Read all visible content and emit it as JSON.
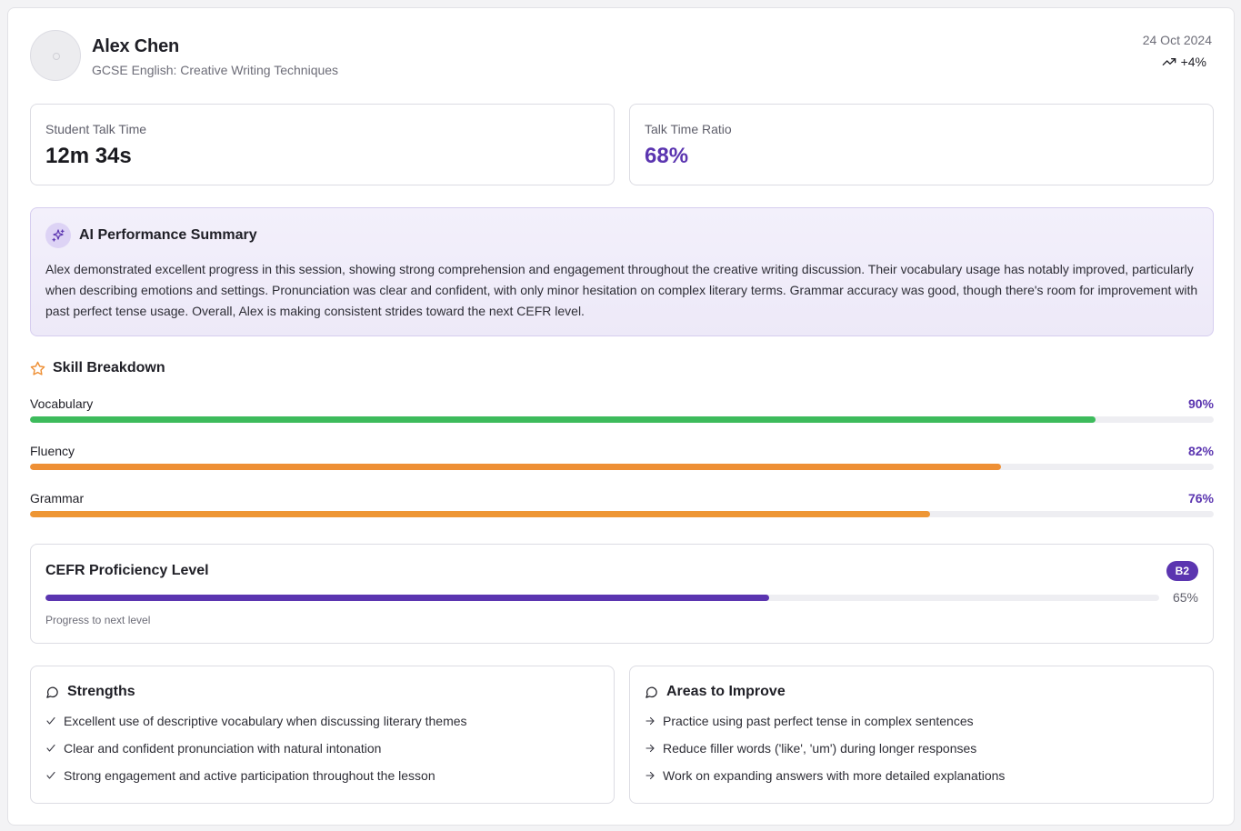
{
  "student": {
    "name": "Alex Chen",
    "course": "GCSE English: Creative Writing Techniques",
    "date": "24 Oct 2024",
    "trend": "+4%"
  },
  "stats": {
    "talk_time": {
      "label": "Student Talk Time",
      "value": "12m 34s"
    },
    "talk_ratio": {
      "label": "Talk Time Ratio",
      "value": "68%"
    }
  },
  "summary": {
    "title": "AI Performance Summary",
    "text": "Alex demonstrated excellent progress in this session, showing strong comprehension and engagement throughout the creative writing discussion. Their vocabulary usage has notably improved, particularly when describing emotions and settings. Pronunciation was clear and confident, with only minor hesitation on complex literary terms. Grammar accuracy was good, though there's room for improvement with past perfect tense usage. Overall, Alex is making consistent strides toward the next CEFR level."
  },
  "skills": {
    "title": "Skill Breakdown",
    "items": [
      {
        "name": "Vocabulary",
        "pct": "90%",
        "value": 0.9,
        "color": "#3dbb5c"
      },
      {
        "name": "Fluency",
        "pct": "82%",
        "value": 0.82,
        "color": "#ee8f34"
      },
      {
        "name": "Grammar",
        "pct": "76%",
        "value": 0.76,
        "color": "#ee9634"
      }
    ]
  },
  "cefr": {
    "title": "CEFR Proficiency Level",
    "level": "B2",
    "progress_label": "65%",
    "progress": 0.65,
    "note": "Progress to next level"
  },
  "strengths": {
    "title": "Strengths",
    "items": [
      "Excellent use of descriptive vocabulary when discussing literary themes",
      "Clear and confident pronunciation with natural intonation",
      "Strong engagement and active participation throughout the lesson"
    ]
  },
  "improve": {
    "title": "Areas to Improve",
    "items": [
      "Practice using past perfect tense in complex sentences",
      "Reduce filler words ('like', 'um') during longer responses",
      "Work on expanding answers with more detailed explanations"
    ]
  },
  "colors": {
    "accent": "#5b35b0",
    "star": "#ee8f34"
  },
  "icons": {
    "avatar": "avatar-placeholder",
    "trend": "trending-up-icon",
    "summary": "sparkles-icon",
    "skills": "star-icon",
    "strengths": "message-circle-icon",
    "improve": "message-circle-icon",
    "strength_mark": "check-icon",
    "improve_mark": "arrow-right-icon"
  }
}
